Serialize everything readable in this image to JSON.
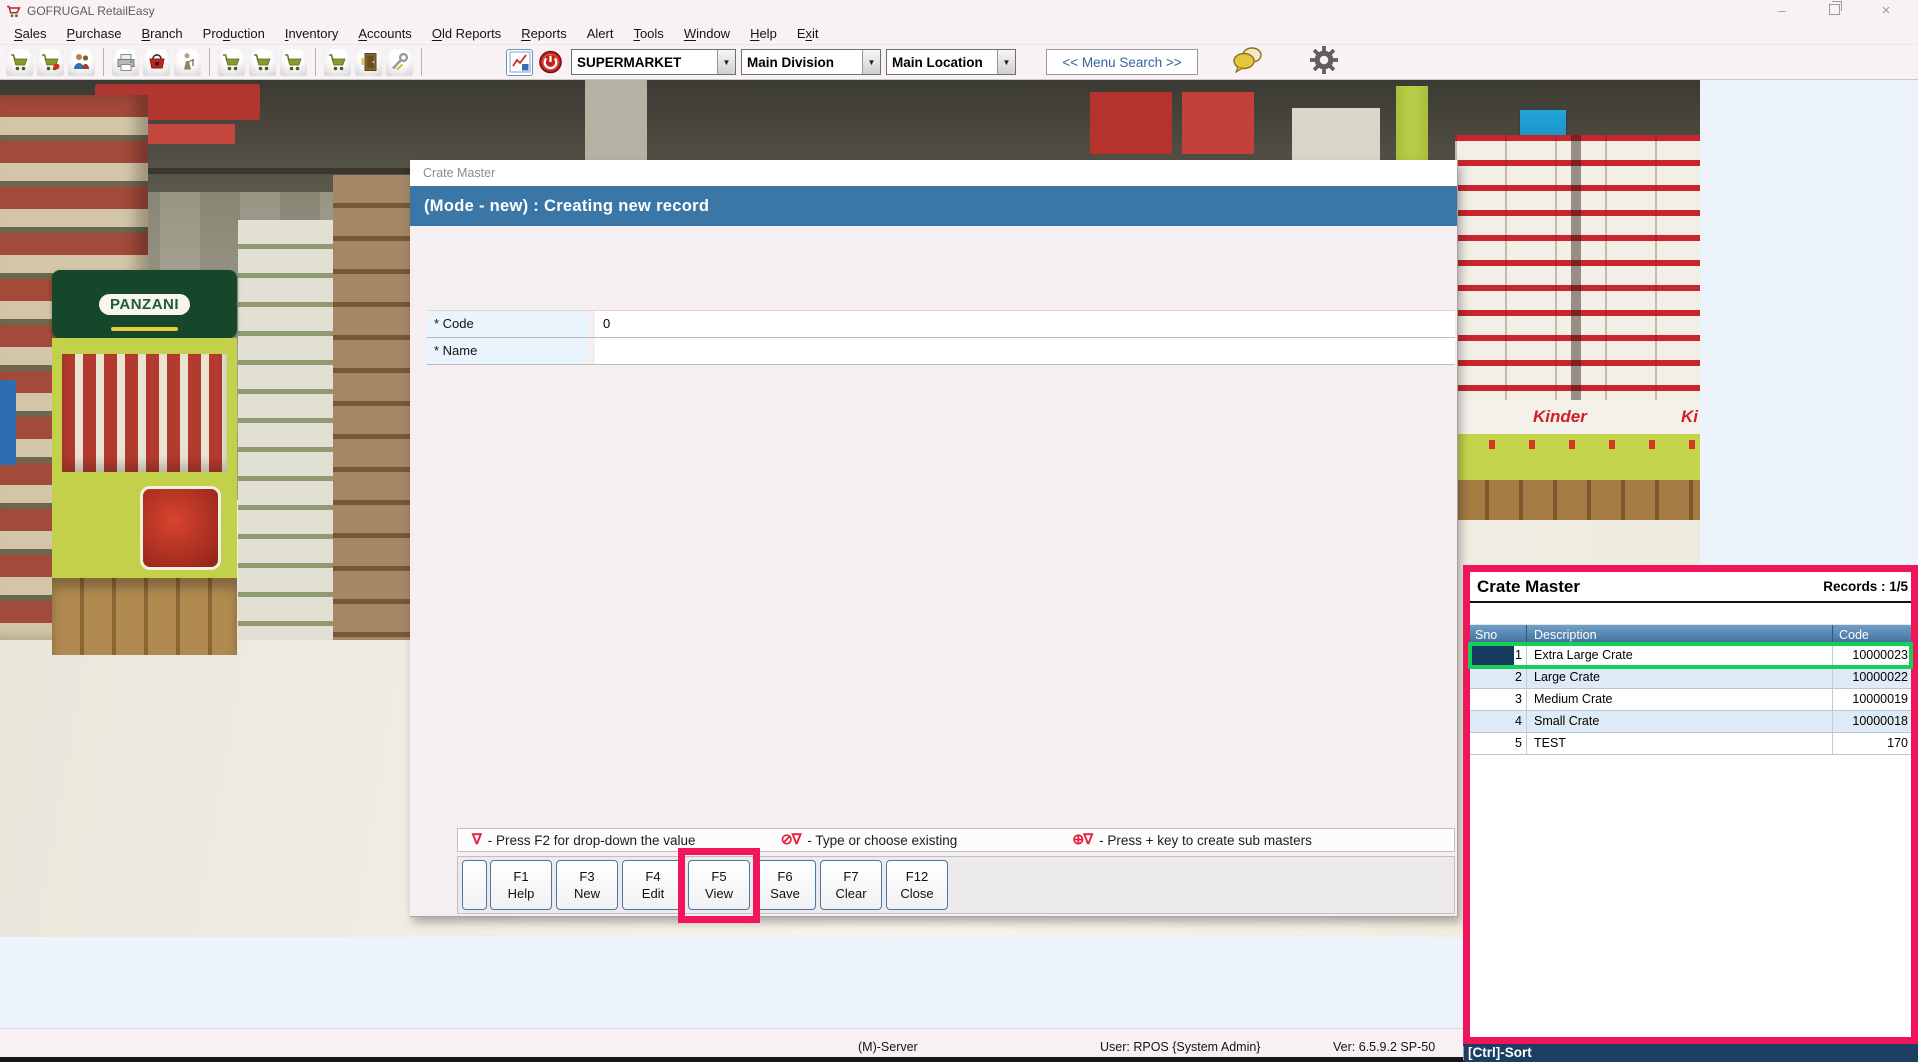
{
  "window": {
    "title": "GOFRUGAL RetailEasy"
  },
  "menu_bar": {
    "items": [
      {
        "label": "Sales",
        "underline": 0
      },
      {
        "label": "Purchase",
        "underline": 0
      },
      {
        "label": "Branch",
        "underline": 0
      },
      {
        "label": "Production",
        "underline": 3
      },
      {
        "label": "Inventory",
        "underline": 0
      },
      {
        "label": "Accounts",
        "underline": 0
      },
      {
        "label": "Old Reports",
        "underline": 0
      },
      {
        "label": "Reports",
        "underline": 0
      },
      {
        "label": "Alert",
        "underline": -1
      },
      {
        "label": "Tools",
        "underline": 0
      },
      {
        "label": "Window",
        "underline": 0
      },
      {
        "label": "Help",
        "underline": 0
      },
      {
        "label": "Exit",
        "underline": 1
      }
    ]
  },
  "toolbar": {
    "icons": [
      "sales-cart-icon",
      "sales-return-icon",
      "customers-icon",
      "print-icon",
      "purchase-basket-icon",
      "goods-receipt-icon",
      "stock-cart-icon",
      "transfer-cart-icon",
      "order-cart-icon",
      "inventory-cart-icon",
      "stock-room-icon",
      "service-tools-icon",
      "reports-chart-icon",
      "power-icon",
      "chat-icon",
      "settings-gear-icon"
    ],
    "dropdown_arrow": "▼",
    "store_selector": {
      "value": "SUPERMARKET"
    },
    "division_selector": {
      "value": "Main Division"
    },
    "location_selector": {
      "value": "Main Location"
    },
    "menu_search_label": "<< Menu Search >>"
  },
  "photo": {
    "panzani_sign": "PANZANI",
    "kinder_brand": "Kinder",
    "kinder_brand_partial": "Ki"
  },
  "dialog": {
    "title": "Crate Master",
    "mode_header": "(Mode - new) : Creating new record",
    "fields": [
      {
        "label": "* Code",
        "value": "0"
      },
      {
        "label": "* Name",
        "value": ""
      }
    ],
    "hints": [
      {
        "symbol": "∇",
        "text": "- Press F2 for drop-down the value"
      },
      {
        "symbol": "⊘∇",
        "text": "- Type or choose existing"
      },
      {
        "symbol": "⊕∇",
        "text": "- Press + key to create sub masters"
      }
    ],
    "buttons": [
      {
        "key": "F1",
        "label": "Help"
      },
      {
        "key": "F3",
        "label": "New"
      },
      {
        "key": "F4",
        "label": "Edit"
      },
      {
        "key": "F5",
        "label": "View",
        "highlighted": true
      },
      {
        "key": "F6",
        "label": "Save"
      },
      {
        "key": "F7",
        "label": "Clear"
      },
      {
        "key": "F12",
        "label": "Close"
      }
    ]
  },
  "records_panel": {
    "title": "Crate Master",
    "records_label": "Records : 1/5",
    "columns": [
      "Sno",
      "Description",
      "Code"
    ],
    "rows": [
      {
        "sno": "1",
        "description": "Extra Large Crate",
        "code": "10000023",
        "selected": true
      },
      {
        "sno": "2",
        "description": "Large Crate",
        "code": "10000022",
        "selected": false
      },
      {
        "sno": "3",
        "description": "Medium Crate",
        "code": "10000019",
        "selected": false
      },
      {
        "sno": "4",
        "description": "Small Crate",
        "code": "10000018",
        "selected": false
      },
      {
        "sno": "5",
        "description": "TEST",
        "code": "170",
        "selected": false
      }
    ],
    "sort_hint": "[Ctrl]-Sort"
  },
  "status_bar": {
    "server": "(M)-Server",
    "user": "User: RPOS {System Admin}",
    "version": "Ver: 6.5.9.2 SP-50"
  },
  "colors": {
    "header_blue": "#3A77A6",
    "panel_header_blue": "#3A6B99",
    "highlight_pink": "#F0145A",
    "highlight_green": "#17CF56",
    "selection_navy": "#16395E",
    "titlebar_pink": "#F9F2F5"
  }
}
